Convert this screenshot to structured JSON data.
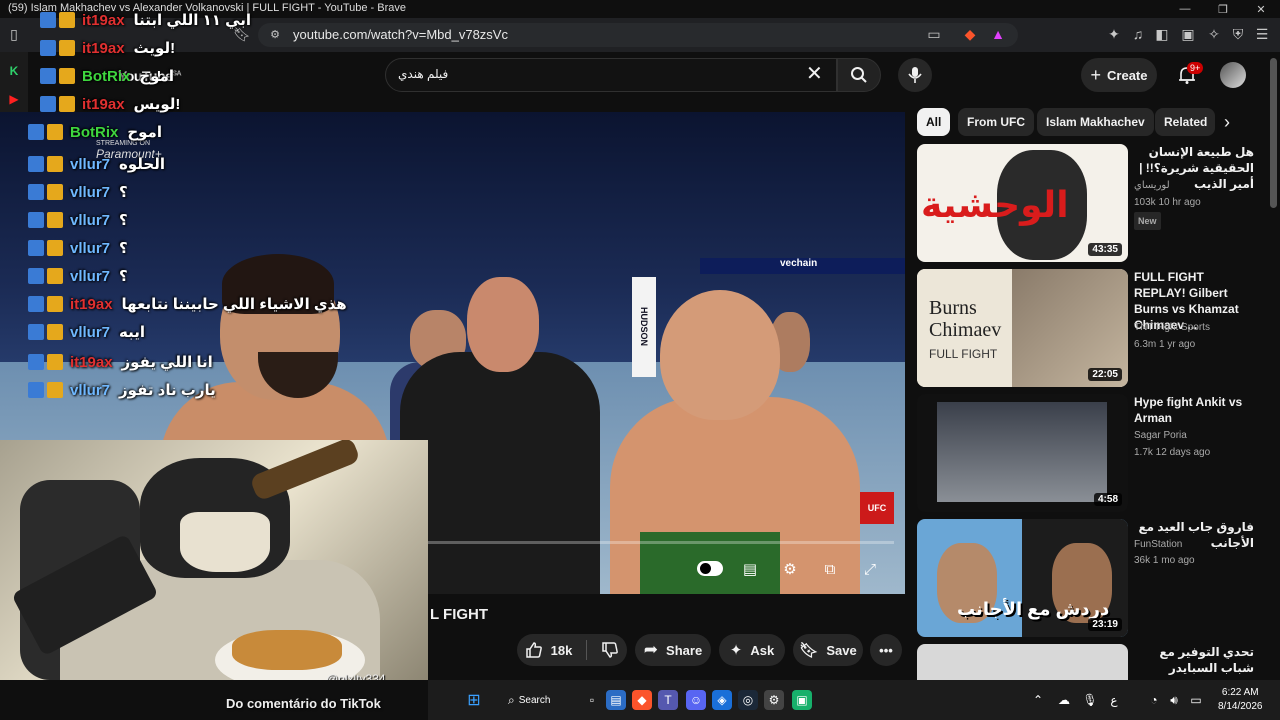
{
  "browser": {
    "title": "(59) Islam Makhachev vs Alexander Volkanovski | FULL FIGHT - YouTube - Brave",
    "url": "youtube.com/watch?v=Mbd_v78zsVc"
  },
  "youtube": {
    "search_value": "فيلم هندي",
    "create_label": "Create",
    "notif_count": "9+",
    "logo_text": "YouTube",
    "logo_region": "SA"
  },
  "video": {
    "title_visible": "L FIGHT",
    "likes": "18k",
    "share_label": "Share",
    "ask_label": "Ask",
    "save_label": "Save",
    "overlay_streaming": "STREAMING ON",
    "overlay_paramount": "Paramount+"
  },
  "chips": [
    "All",
    "From UFC",
    "Islam Makhachev",
    "Related"
  ],
  "recommendations": [
    {
      "title": "هل طبيعة الإنسان الحقيقية شريرة؟!! | أمير الذيب",
      "channel": "لوريساي",
      "meta": "103k  10 hr ago",
      "badge": "New",
      "duration": "43:35",
      "thumb_text": "الوحشية"
    },
    {
      "title": "FULL FIGHT REPLAY! Gilbert Burns vs Khamzat Chimaev ...",
      "channel": "TNT Fight Sports",
      "meta": "6.3m  1 yr ago",
      "badge": "",
      "duration": "22:05",
      "thumb_text": "Burns Chimaev",
      "thumb_sub": "FULL FIGHT"
    },
    {
      "title": "Hype fight Ankit vs Arman",
      "channel": "Sagar Poria",
      "meta": "1.7k  12 days ago",
      "badge": "",
      "duration": "4:58",
      "thumb_text": ""
    },
    {
      "title": "فاروق جاب العيد مع الأجانب",
      "channel": "FunStation",
      "meta": "36k  1 mo ago",
      "badge": "",
      "duration": "23:19",
      "thumb_text": "دردش مع الأجانب"
    },
    {
      "title": "تحدي التوفير مع شباب السبايدر",
      "channel": "",
      "meta": "",
      "badge": "",
      "duration": "",
      "thumb_text": ""
    }
  ],
  "chat": [
    {
      "name": "it19ax",
      "msg": "ابي ١١ اللي ابتنا",
      "color": "#e03030"
    },
    {
      "name": "it19ax",
      "msg": "لويث!",
      "color": "#e03030"
    },
    {
      "name": "BotRix",
      "msg": "اموح",
      "color": "#3ed63e"
    },
    {
      "name": "it19ax",
      "msg": "لويس!",
      "color": "#e03030"
    },
    {
      "name": "BotRix",
      "msg": "اموح",
      "color": "#3ed63e"
    },
    {
      "name": "vllur7",
      "msg": "الحلوه",
      "color": "#6fb8ff"
    },
    {
      "name": "vllur7",
      "msg": "؟",
      "color": "#6fb8ff"
    },
    {
      "name": "vllur7",
      "msg": "؟",
      "color": "#6fb8ff"
    },
    {
      "name": "vllur7",
      "msg": "؟",
      "color": "#6fb8ff"
    },
    {
      "name": "vllur7",
      "msg": "؟",
      "color": "#6fb8ff"
    },
    {
      "name": "it19ax",
      "msg": "هذي الاشياء اللي حابيننا نتابعها",
      "color": "#e03030"
    },
    {
      "name": "vllur7",
      "msg": "ايبه",
      "color": "#6fb8ff"
    },
    {
      "name": "it19ax",
      "msg": "انا اللي يفوز",
      "color": "#e03030"
    },
    {
      "name": "vllur7",
      "msg": "يارب ناد تفوز",
      "color": "#6fb8ff"
    }
  ],
  "webcam": {
    "tiktok_handle": "@plxlty334",
    "tiktok_caption": "Do comentário do TikTok"
  },
  "taskbar": {
    "search_label": "Search",
    "time": "6:22 AM",
    "date": "8/14/2026",
    "lang": "ع"
  }
}
